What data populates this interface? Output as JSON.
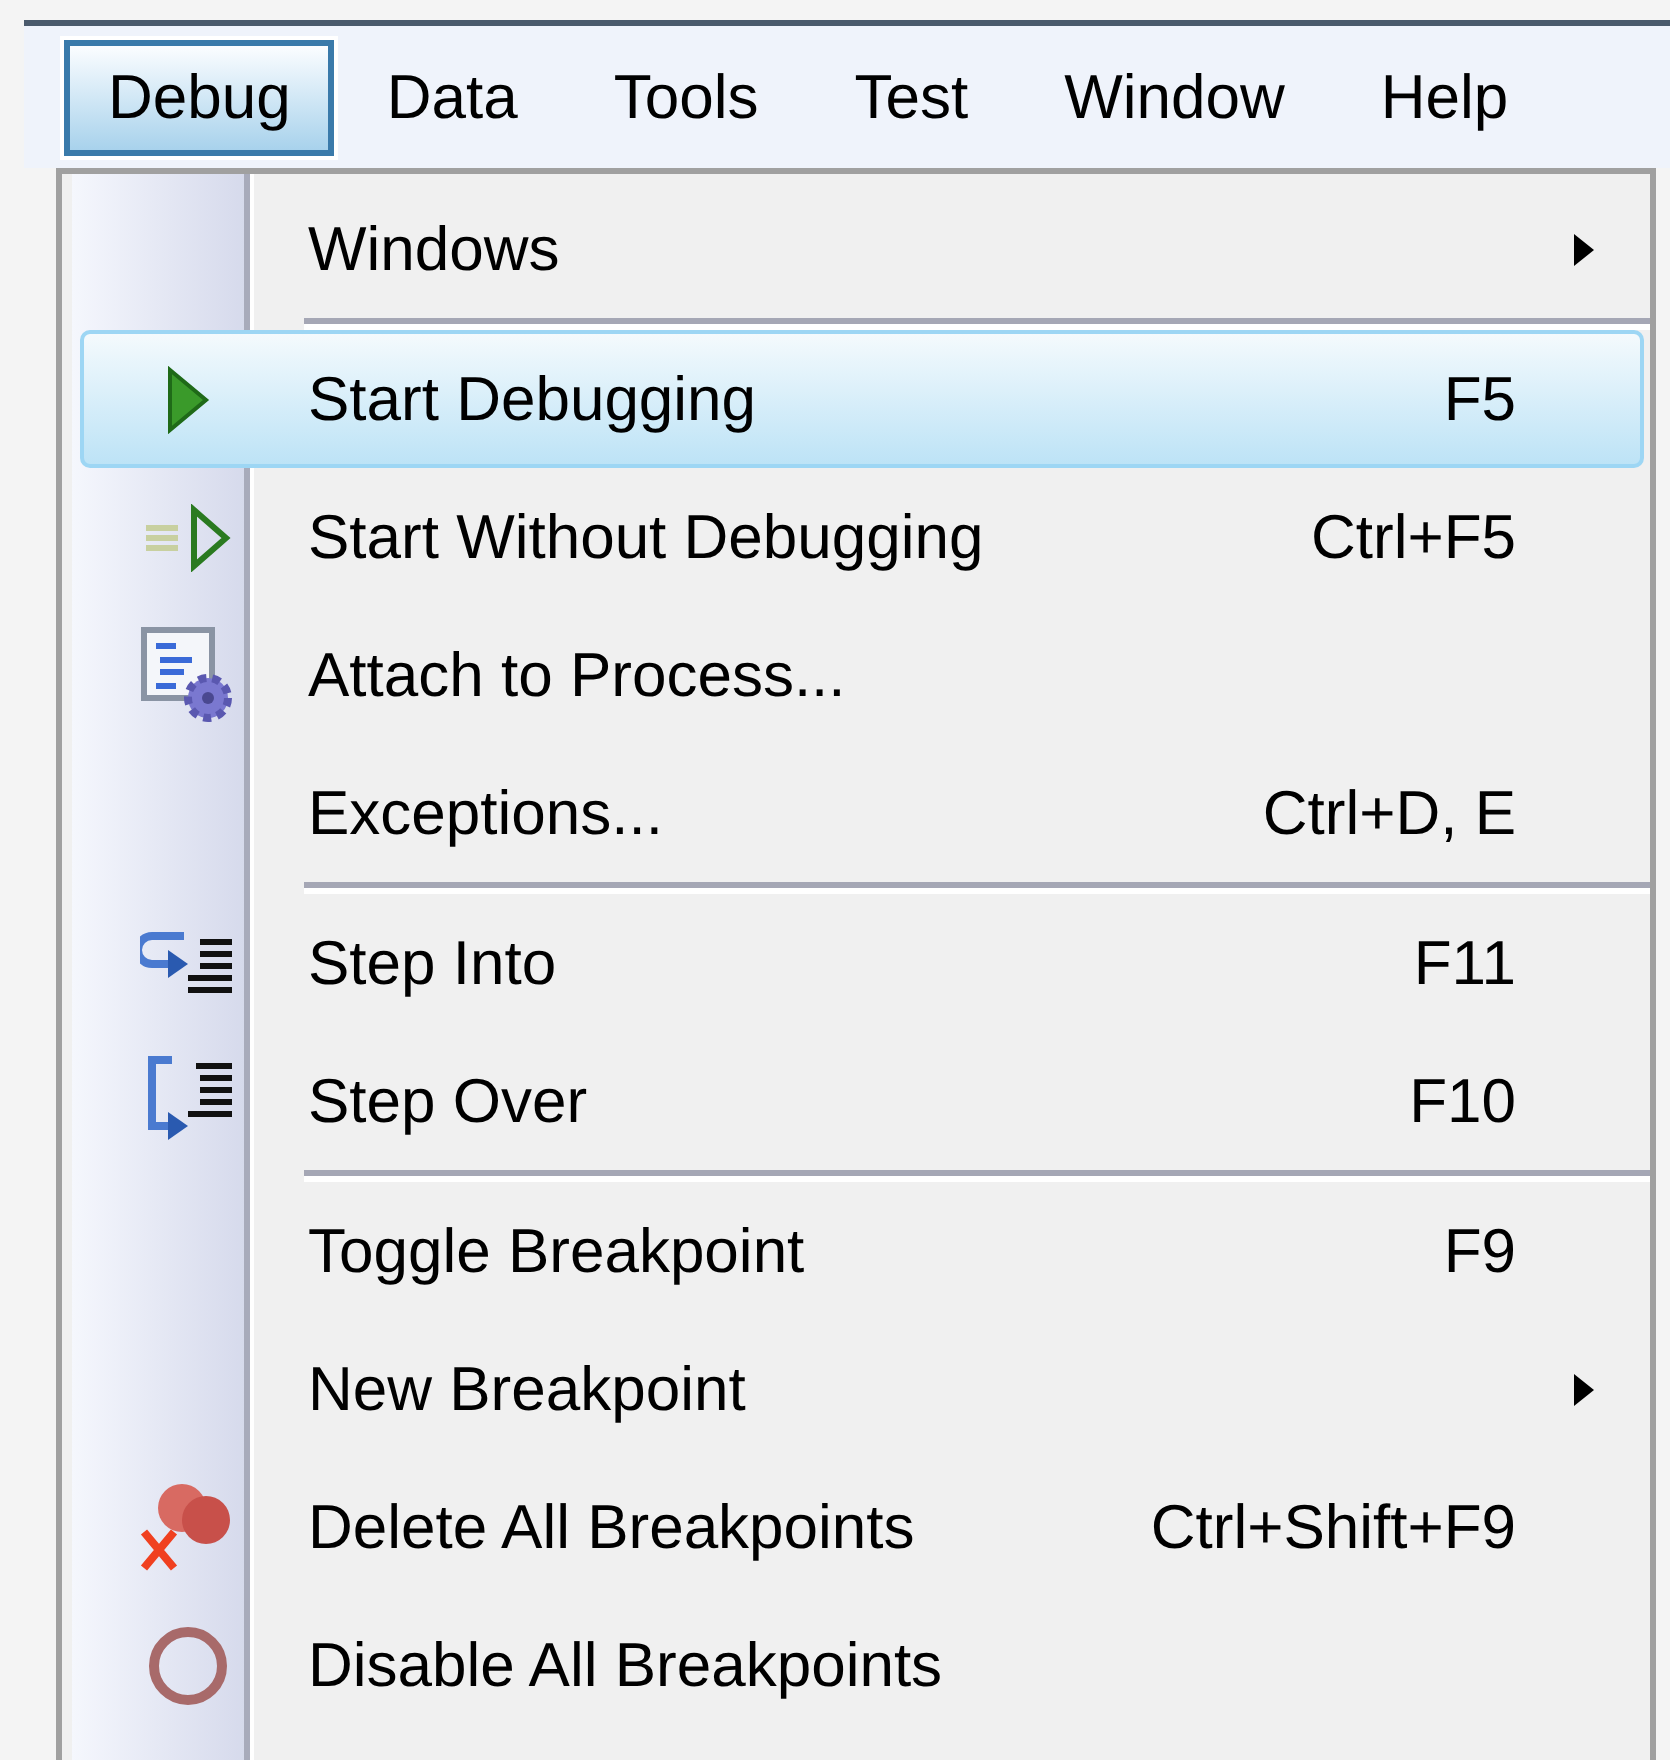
{
  "menu_bar": {
    "items": [
      {
        "label": "Debug",
        "selected": true
      },
      {
        "label": "Data",
        "selected": false
      },
      {
        "label": "Tools",
        "selected": false
      },
      {
        "label": "Test",
        "selected": false
      },
      {
        "label": "Window",
        "selected": false
      },
      {
        "label": "Help",
        "selected": false
      }
    ]
  },
  "menu": {
    "items": [
      {
        "kind": "item",
        "label": "Windows",
        "submenu": true,
        "selected": false
      },
      {
        "kind": "separator"
      },
      {
        "kind": "item",
        "label": "Start Debugging",
        "shortcut": "F5",
        "submenu": false,
        "selected": true
      },
      {
        "kind": "item",
        "label": "Start Without Debugging",
        "shortcut": "Ctrl+F5",
        "submenu": false,
        "selected": false
      },
      {
        "kind": "item",
        "label": "Attach to Process...",
        "submenu": false,
        "selected": false
      },
      {
        "kind": "item",
        "label": "Exceptions...",
        "shortcut": "Ctrl+D, E",
        "submenu": false,
        "selected": false
      },
      {
        "kind": "separator"
      },
      {
        "kind": "item",
        "label": "Step Into",
        "shortcut": "F11",
        "submenu": false,
        "selected": false
      },
      {
        "kind": "item",
        "label": "Step Over",
        "shortcut": "F10",
        "submenu": false,
        "selected": false
      },
      {
        "kind": "separator"
      },
      {
        "kind": "item",
        "label": "Toggle Breakpoint",
        "shortcut": "F9",
        "submenu": false,
        "selected": false
      },
      {
        "kind": "item",
        "label": "New Breakpoint",
        "submenu": true,
        "selected": false
      },
      {
        "kind": "item",
        "label": "Delete All Breakpoints",
        "shortcut": "Ctrl+Shift+F9",
        "submenu": false,
        "selected": false
      },
      {
        "kind": "item",
        "label": "Disable All Breakpoints",
        "submenu": false,
        "selected": false
      }
    ]
  }
}
